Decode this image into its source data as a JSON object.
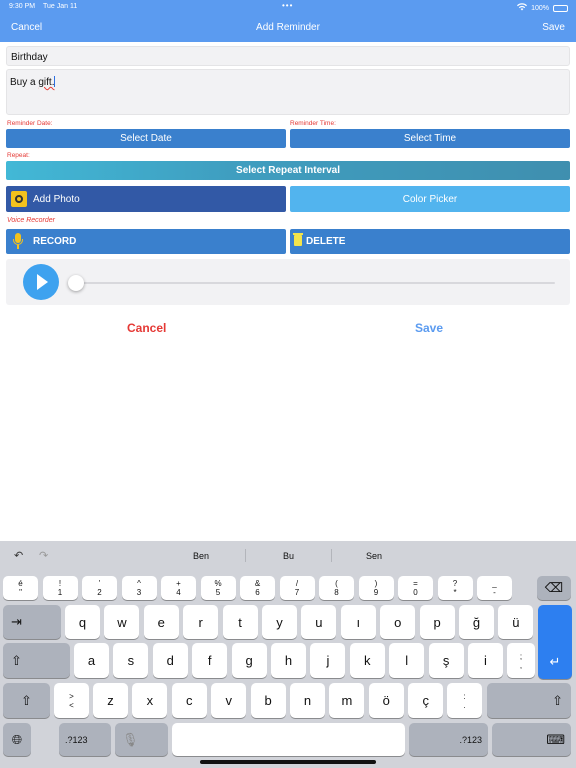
{
  "status_bar": {
    "time": "9:30 PM",
    "date": "Tue Jan 11",
    "battery": "100%"
  },
  "nav": {
    "cancel": "Cancel",
    "title": "Add Reminder",
    "save": "Save"
  },
  "form": {
    "title_value": "Birthday",
    "notes_prefix": "Buy a ",
    "notes_misspelled": "gift.",
    "reminder_date_label": "Reminder Date:",
    "reminder_time_label": "Reminder Time:",
    "select_date": "Select Date",
    "select_time": "Select Time",
    "repeat_label": "Repeat:",
    "select_repeat": "Select Repeat Interval",
    "add_photo": "Add Photo",
    "color_picker": "Color Picker",
    "voice_label": "Voice Recorder",
    "record": "RECORD",
    "delete": "DELETE",
    "playback_progress": 0
  },
  "actions": {
    "cancel": "Cancel",
    "save": "Save"
  },
  "keyboard": {
    "suggestions": [
      "Ben",
      "Bu",
      "Sen"
    ],
    "number_row": [
      [
        "é",
        "\""
      ],
      [
        "!",
        "1"
      ],
      [
        "'",
        "2"
      ],
      [
        "^",
        "3"
      ],
      [
        "+",
        "4"
      ],
      [
        "%",
        "5"
      ],
      [
        "&",
        "6"
      ],
      [
        "/",
        "7"
      ],
      [
        "(",
        "8"
      ],
      [
        ")",
        "9"
      ],
      [
        "=",
        "0"
      ],
      [
        "?",
        "*"
      ],
      [
        "_",
        "-"
      ]
    ],
    "row1": [
      "q",
      "w",
      "e",
      "r",
      "t",
      "y",
      "u",
      "ı",
      "o",
      "p",
      "ğ",
      "ü"
    ],
    "row2": [
      "a",
      "s",
      "d",
      "f",
      "g",
      "h",
      "j",
      "k",
      "l",
      "ş",
      "i"
    ],
    "row2_punct": [
      ";",
      ","
    ],
    "row3_punct": [
      ">",
      "<"
    ],
    "row3": [
      "z",
      "x",
      "c",
      "v",
      "b",
      "n",
      "m",
      "ö",
      "ç"
    ],
    "row3_end": [
      ":",
      "."
    ],
    "numbers_key": ".?123",
    "icons": {
      "undo": "undo-icon",
      "redo": "redo-icon",
      "delete": "backspace-icon",
      "tab": "tab-icon",
      "shift": "shift-icon",
      "return": "return-icon",
      "globe": "globe-icon",
      "mic": "mic-icon",
      "hide": "keyboard-hide-icon"
    }
  }
}
